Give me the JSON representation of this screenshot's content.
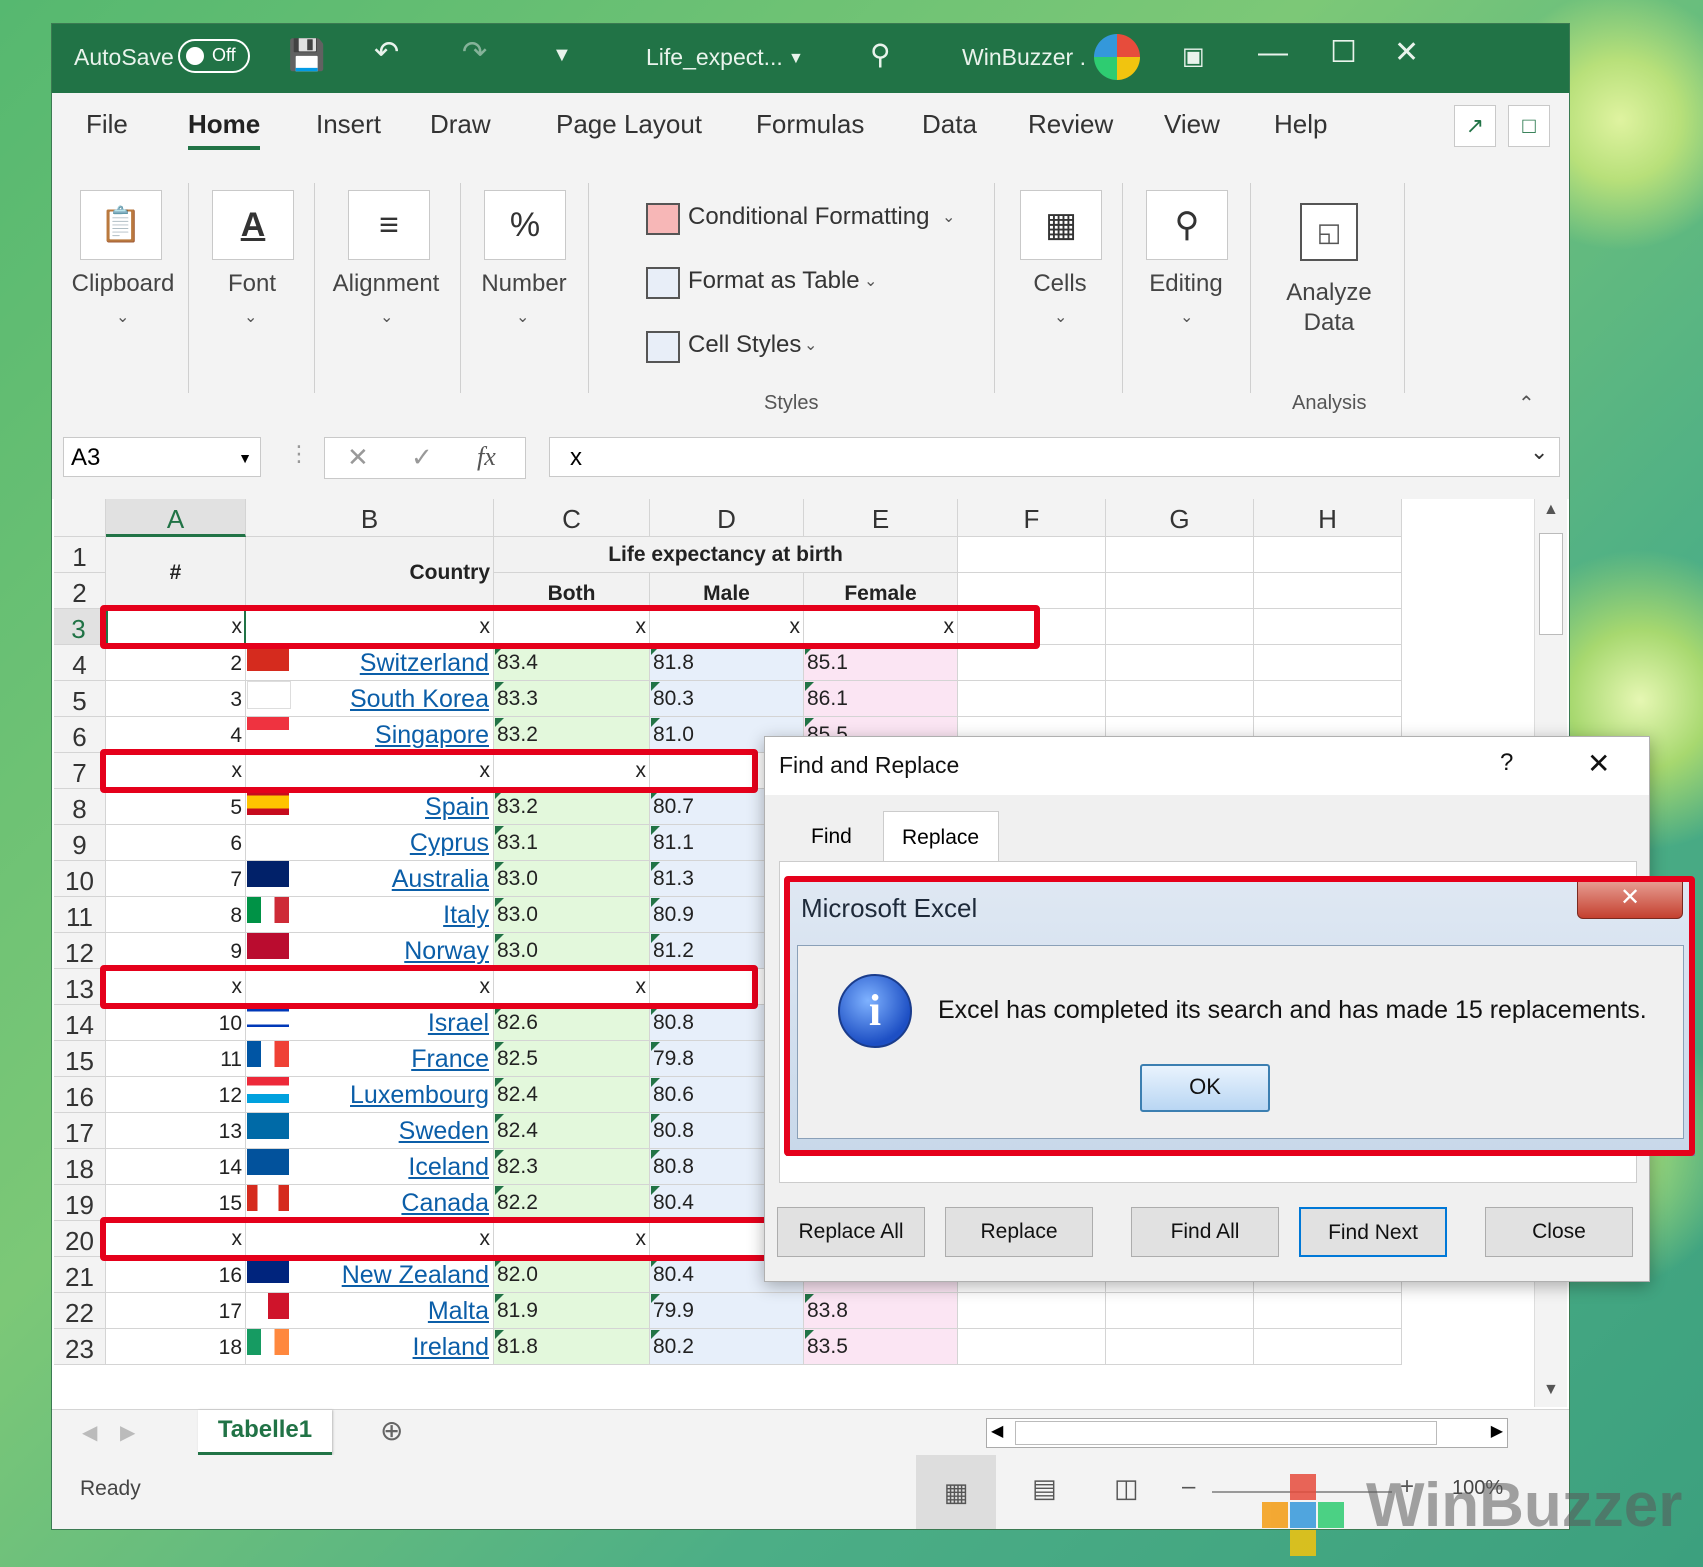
{
  "titlebar": {
    "autosave": "AutoSave",
    "toggle": "Off",
    "filename": "Life_expect...",
    "account": "WinBuzzer ."
  },
  "tabs": [
    "File",
    "Home",
    "Insert",
    "Draw",
    "Page Layout",
    "Formulas",
    "Data",
    "Review",
    "View",
    "Help"
  ],
  "ribbon": {
    "clipboard": "Clipboard",
    "font": "Font",
    "alignment": "Alignment",
    "number": "Number",
    "cond_format": "Conditional Formatting",
    "format_table": "Format as Table",
    "cell_styles": "Cell Styles",
    "styles_group": "Styles",
    "cells": "Cells",
    "editing": "Editing",
    "analyze_line1": "Analyze",
    "analyze_line2": "Data",
    "analysis_group": "Analysis"
  },
  "formula": {
    "namebox": "A3",
    "fx": "fx",
    "value": "x"
  },
  "columns": [
    "A",
    "B",
    "C",
    "D",
    "E",
    "F",
    "G",
    "H"
  ],
  "header": {
    "hash": "#",
    "country": "Country",
    "life": "Life expectancy at birth",
    "both": "Both",
    "male": "Male",
    "female": "Female"
  },
  "rows": [
    {
      "r": "1"
    },
    {
      "r": "2"
    },
    {
      "r": "3",
      "x": true,
      "xcols": 5
    },
    {
      "r": "4",
      "n": "2",
      "country": "Switzerland",
      "both": "83.4",
      "male": "81.8",
      "female": "85.1",
      "flag": "ch"
    },
    {
      "r": "5",
      "n": "3",
      "country": "South Korea",
      "both": "83.3",
      "male": "80.3",
      "female": "86.1",
      "flag": "kr"
    },
    {
      "r": "6",
      "n": "4",
      "country": "Singapore",
      "both": "83.2",
      "male": "81.0",
      "female": "85.5",
      "flag": "sg"
    },
    {
      "r": "7",
      "x": true,
      "xcols": 3
    },
    {
      "r": "8",
      "n": "5",
      "country": "Spain",
      "both": "83.2",
      "male": "80.7",
      "female": "",
      "flag": "es"
    },
    {
      "r": "9",
      "n": "6",
      "country": "Cyprus",
      "both": "83.1",
      "male": "81.1",
      "female": "",
      "flag": "cy"
    },
    {
      "r": "10",
      "n": "7",
      "country": "Australia",
      "both": "83.0",
      "male": "81.3",
      "female": "",
      "flag": "au"
    },
    {
      "r": "11",
      "n": "8",
      "country": "Italy",
      "both": "83.0",
      "male": "80.9",
      "female": "",
      "flag": "it"
    },
    {
      "r": "12",
      "n": "9",
      "country": "Norway",
      "both": "83.0",
      "male": "81.2",
      "female": "",
      "flag": "no"
    },
    {
      "r": "13",
      "x": true,
      "xcols": 3
    },
    {
      "r": "14",
      "n": "10",
      "country": "Israel",
      "both": "82.6",
      "male": "80.8",
      "female": "",
      "flag": "il"
    },
    {
      "r": "15",
      "n": "11",
      "country": "France",
      "both": "82.5",
      "male": "79.8",
      "female": "",
      "flag": "fr"
    },
    {
      "r": "16",
      "n": "12",
      "country": "Luxembourg",
      "both": "82.4",
      "male": "80.6",
      "female": "",
      "flag": "lu"
    },
    {
      "r": "17",
      "n": "13",
      "country": "Sweden",
      "both": "82.4",
      "male": "80.8",
      "female": "",
      "flag": "se"
    },
    {
      "r": "18",
      "n": "14",
      "country": "Iceland",
      "both": "82.3",
      "male": "80.8",
      "female": "",
      "flag": "is"
    },
    {
      "r": "19",
      "n": "15",
      "country": "Canada",
      "both": "82.2",
      "male": "80.4",
      "female": "",
      "flag": "ca"
    },
    {
      "r": "20",
      "x": true,
      "xcols": 5
    },
    {
      "r": "21",
      "n": "16",
      "country": "New Zealand",
      "both": "82.0",
      "male": "80.4",
      "female": "83.5",
      "flag": "nz"
    },
    {
      "r": "22",
      "n": "17",
      "country": "Malta",
      "both": "81.9",
      "male": "79.9",
      "female": "83.8",
      "flag": "mt"
    },
    {
      "r": "23",
      "n": "18",
      "country": "Ireland",
      "both": "81.8",
      "male": "80.2",
      "female": "83.5",
      "flag": "ie"
    }
  ],
  "x_mark": "x",
  "sheet": {
    "name": "Tabelle1"
  },
  "status": {
    "ready": "Ready",
    "zoom": "100%"
  },
  "find_replace": {
    "title": "Find and Replace",
    "help": "?",
    "tab_find": "Find",
    "tab_replace": "Replace",
    "btn_replace_all": "Replace All",
    "btn_replace": "Replace",
    "btn_find_all": "Find All",
    "btn_find_next": "Find Next",
    "btn_close": "Close"
  },
  "msgbox": {
    "title": "Microsoft Excel",
    "text": "Excel has completed its search and has made 15 replacements.",
    "ok": "OK"
  },
  "watermark": "WinBuzzer"
}
